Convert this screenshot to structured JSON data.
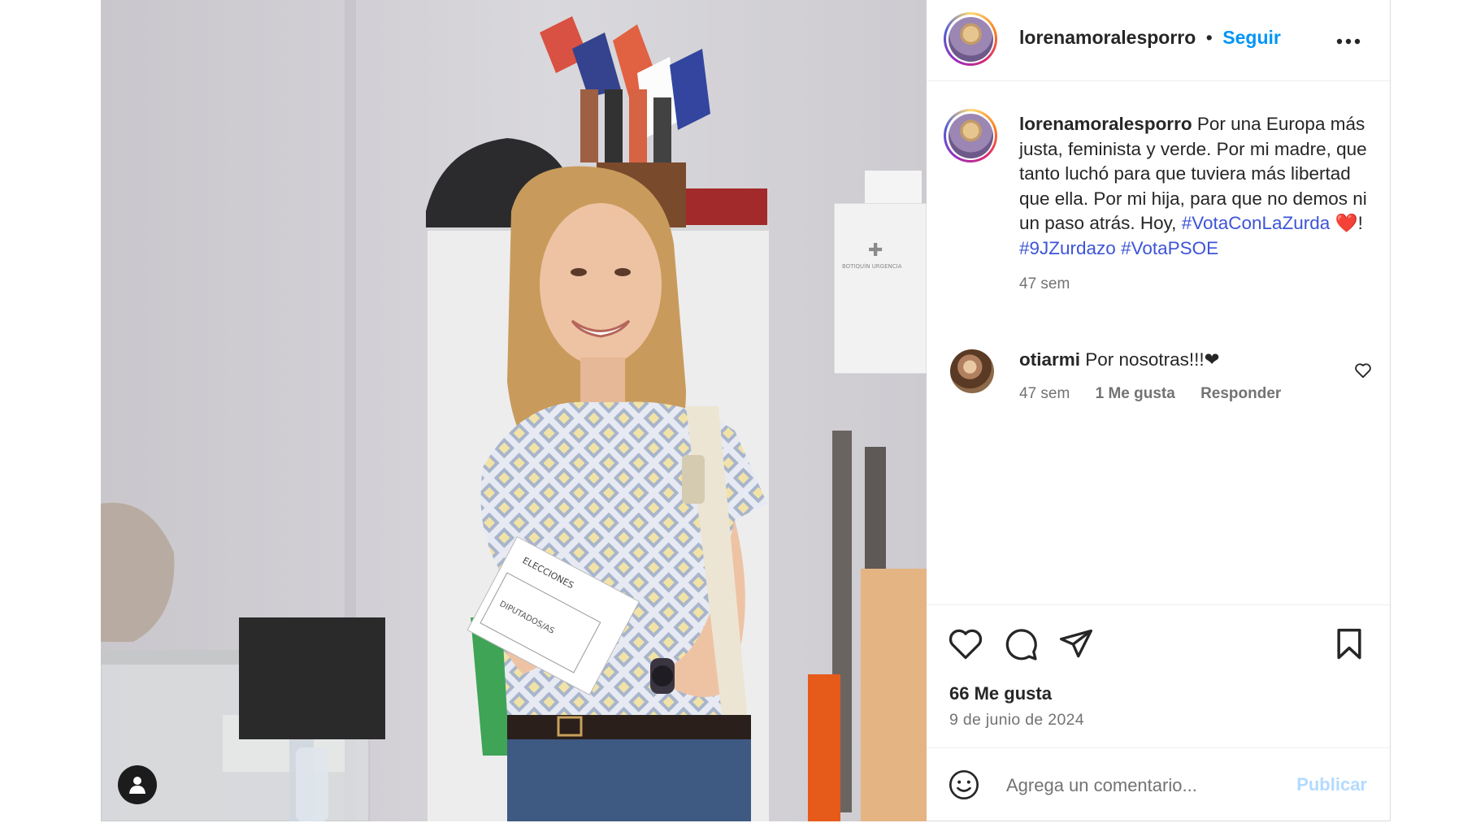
{
  "post": {
    "author": {
      "username": "lorenamoralesporro",
      "follow_label": "Seguir",
      "separator": "•"
    },
    "caption": {
      "username": "lorenamoralesporro",
      "text": "Por una Europa más justa, feminista y verde. Por mi madre, que tanto luchó para que tuviera más libertad que ella. Por mi hija, para que no demos ni un paso atrás. Hoy, ",
      "hashtag_1": "#VotaConLaZurda",
      "emoji": "❤️",
      "exclaim": "!",
      "hashtag_2": "#9JZurdazo",
      "hashtag_3": "#VotaPSOE",
      "time": "47 sem"
    },
    "comments": [
      {
        "username": "otiarmi",
        "text": "Por nosotras!!!❤",
        "time": "47 sem",
        "likes": "1 Me gusta",
        "reply_label": "Responder"
      }
    ],
    "likes_label": "66 Me gusta",
    "date": "9 de junio de 2024",
    "comment_box": {
      "placeholder": "Agrega un comentario...",
      "publish_label": "Publicar"
    },
    "photo": {
      "envelope_text_1": "ELECCIONES",
      "envelope_text_2": "DIPUTADOS/AS",
      "cabinet_text": "BOTIQUÍN URGENCIA"
    }
  },
  "icons": {
    "more": "more-horizontal-icon",
    "like": "heart-icon",
    "comment": "comment-icon",
    "share": "send-icon",
    "save": "bookmark-icon",
    "emoji": "emoji-icon",
    "tag": "user-tag-icon"
  },
  "colors": {
    "link_blue": "#0095f6",
    "hashtag": "#3d54d6",
    "muted": "#737373",
    "publish_disabled": "#b3dbff"
  }
}
